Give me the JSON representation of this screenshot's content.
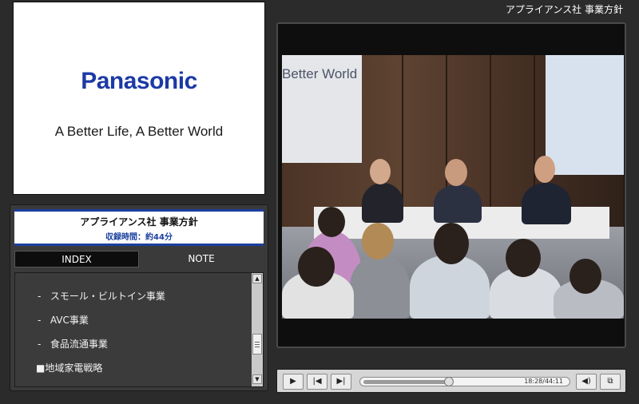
{
  "window": {
    "title": "アプライアンス社 事業方針"
  },
  "slide": {
    "logo_text": "Panasonic",
    "tagline": "A Better Life, A Better World"
  },
  "panel": {
    "title": "アプライアンス社 事業方針",
    "subtitle": "収録時間：約44分",
    "tabs": [
      {
        "label": "INDEX",
        "active": true
      },
      {
        "label": "NOTE",
        "active": false
      }
    ],
    "index_items": [
      {
        "prefix": "-",
        "label": "スモール・ビルトイン事業"
      },
      {
        "prefix": "-",
        "label": "AVC事業"
      },
      {
        "prefix": "-",
        "label": "食品流通事業"
      },
      {
        "prefix": "■",
        "label": "地域家電戦略"
      }
    ],
    "scroll_position": 0.6
  },
  "video": {
    "screen_text": "Better World"
  },
  "controls": {
    "time_display": "18:28/44:11",
    "progress": 0.418,
    "icons": [
      "play-icon",
      "previous-chapter-icon",
      "next-chapter-icon",
      "volume-icon",
      "fullscreen-icon"
    ]
  },
  "colors": {
    "brand_blue": "#1c3aa6",
    "background": "#2b2b2b",
    "panel_accent": "#1a3f9e"
  }
}
